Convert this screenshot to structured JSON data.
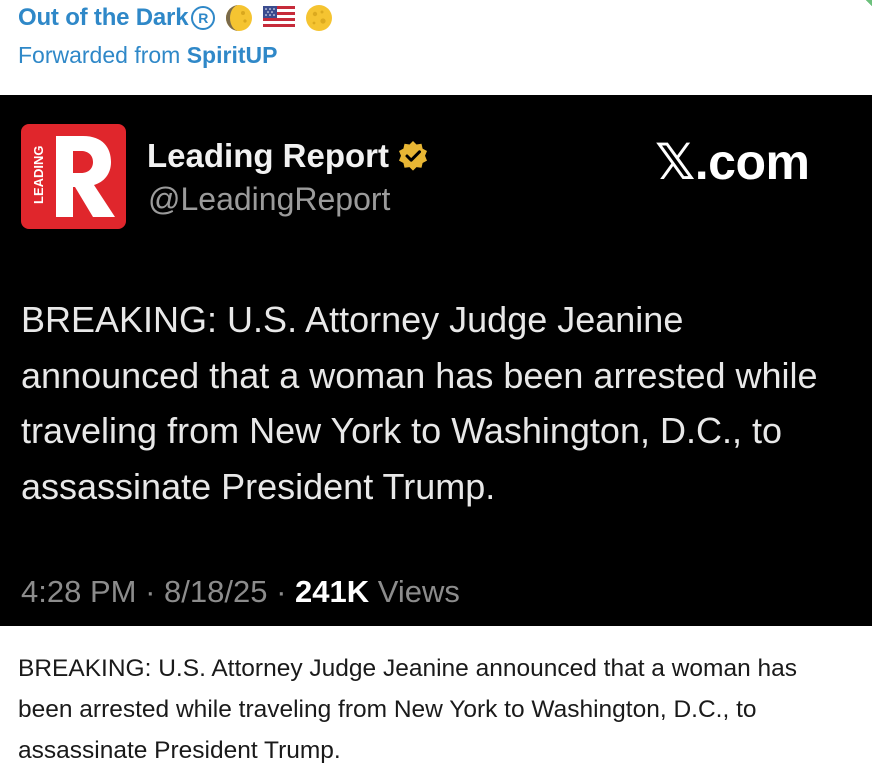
{
  "header": {
    "channel_name": "Out of the Dark",
    "registered_mark": "R",
    "emojis": [
      "moon-emoji",
      "us-flag-emoji",
      "full-moon-emoji"
    ],
    "forwarded_prefix": "Forwarded from",
    "forwarded_source": "SpiritUP"
  },
  "tweet": {
    "logo_text": "LEADING",
    "logo_letter": "R",
    "logo_color": "#e0262c",
    "author_name": "Leading Report",
    "verified_color": "#e8b634",
    "handle": "@LeadingReport",
    "site_badge": "𝕏.com",
    "body": "BREAKING: U.S. Attorney Judge Jeanine announced that a woman has been arrested while traveling from New York to Washington, D.C., to assassinate President Trump.",
    "time": "4:28 PM",
    "date": "8/18/25",
    "views_count": "241K",
    "views_label": "Views",
    "separator": "·"
  },
  "caption": "BREAKING: U.S. Attorney Judge Jeanine announced that a woman has been arrested while traveling from New York to Washington, D.C., to assassinate President Trump.",
  "colors": {
    "link_blue": "#2f88c8",
    "tweet_bg": "#000000"
  }
}
